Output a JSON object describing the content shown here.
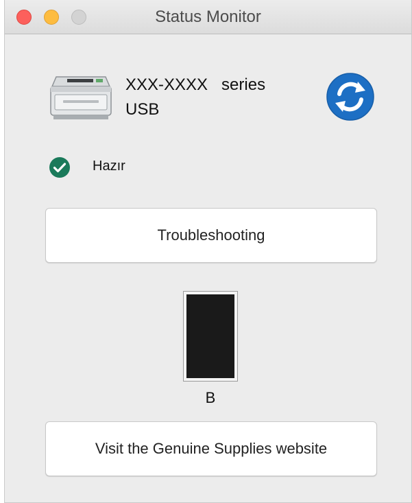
{
  "window": {
    "title": "Status Monitor"
  },
  "device": {
    "name": "XXX-XXXX   series",
    "connection": "USB"
  },
  "status": {
    "text": "Hazır",
    "color": "#1a7a5a"
  },
  "buttons": {
    "troubleshooting": "Troubleshooting",
    "supplies": "Visit the Genuine Supplies website"
  },
  "toner": {
    "label": "B",
    "level": 1.0,
    "color": "#1a1a1a"
  },
  "colors": {
    "refresh": "#1d6fc4",
    "close": "#fc605c",
    "minimize": "#fdbc40",
    "zoom": "#d3d3d3"
  },
  "icons": {
    "printer": "printer-icon",
    "refresh": "refresh-icon",
    "status": "check-circle-icon"
  }
}
